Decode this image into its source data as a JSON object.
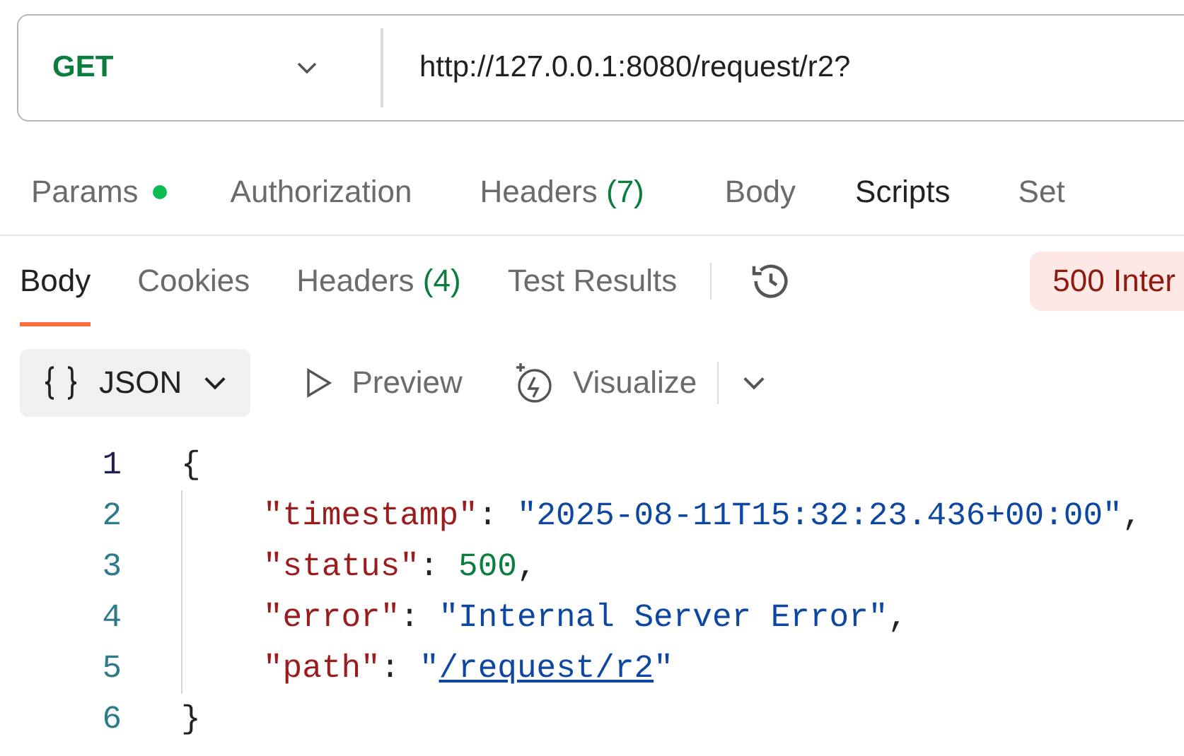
{
  "request": {
    "method": "GET",
    "url": "http://127.0.0.1:8080/request/r2?"
  },
  "request_tabs": [
    {
      "label": "Params",
      "dot": true,
      "has_content": false
    },
    {
      "label": "Authorization",
      "dot": false,
      "has_content": false
    },
    {
      "label": "Headers",
      "count": "(7)",
      "dot": false,
      "has_content": false
    },
    {
      "label": "Body",
      "dot": false,
      "has_content": false
    },
    {
      "label": "Scripts",
      "dot": false,
      "has_content": true
    },
    {
      "label": "Set",
      "dot": false,
      "has_content": false
    }
  ],
  "response_tabs": [
    {
      "label": "Body",
      "selected": true
    },
    {
      "label": "Cookies",
      "selected": false
    },
    {
      "label": "Headers",
      "count": "(4)",
      "selected": false
    },
    {
      "label": "Test Results",
      "selected": false
    }
  ],
  "status_badge": "500 Inter",
  "view_bar": {
    "format": "JSON",
    "preview": "Preview",
    "visualize": "Visualize"
  },
  "code_lines": [
    {
      "number": "1",
      "current": true,
      "indented": false,
      "tokens": [
        {
          "kind": "punct",
          "text": "{"
        }
      ]
    },
    {
      "number": "2",
      "current": false,
      "indented": true,
      "tokens": [
        {
          "kind": "key",
          "text": "\"timestamp\""
        },
        {
          "kind": "punct",
          "text": ": "
        },
        {
          "kind": "string",
          "text": "\"2025-08-11T15:32:23.436+00:00\""
        },
        {
          "kind": "punct",
          "text": ","
        }
      ]
    },
    {
      "number": "3",
      "current": false,
      "indented": true,
      "tokens": [
        {
          "kind": "key",
          "text": "\"status\""
        },
        {
          "kind": "punct",
          "text": ": "
        },
        {
          "kind": "number",
          "text": "500"
        },
        {
          "kind": "punct",
          "text": ","
        }
      ]
    },
    {
      "number": "4",
      "current": false,
      "indented": true,
      "tokens": [
        {
          "kind": "key",
          "text": "\"error\""
        },
        {
          "kind": "punct",
          "text": ": "
        },
        {
          "kind": "string",
          "text": "\"Internal Server Error\""
        },
        {
          "kind": "punct",
          "text": ","
        }
      ]
    },
    {
      "number": "5",
      "current": false,
      "indented": true,
      "tokens": [
        {
          "kind": "key",
          "text": "\"path\""
        },
        {
          "kind": "punct",
          "text": ": "
        },
        {
          "kind": "string",
          "text": "\""
        },
        {
          "kind": "link",
          "text": "/request/r2"
        },
        {
          "kind": "string",
          "text": "\""
        }
      ]
    },
    {
      "number": "6",
      "current": false,
      "indented": false,
      "tokens": [
        {
          "kind": "punct",
          "text": "}"
        }
      ]
    }
  ]
}
